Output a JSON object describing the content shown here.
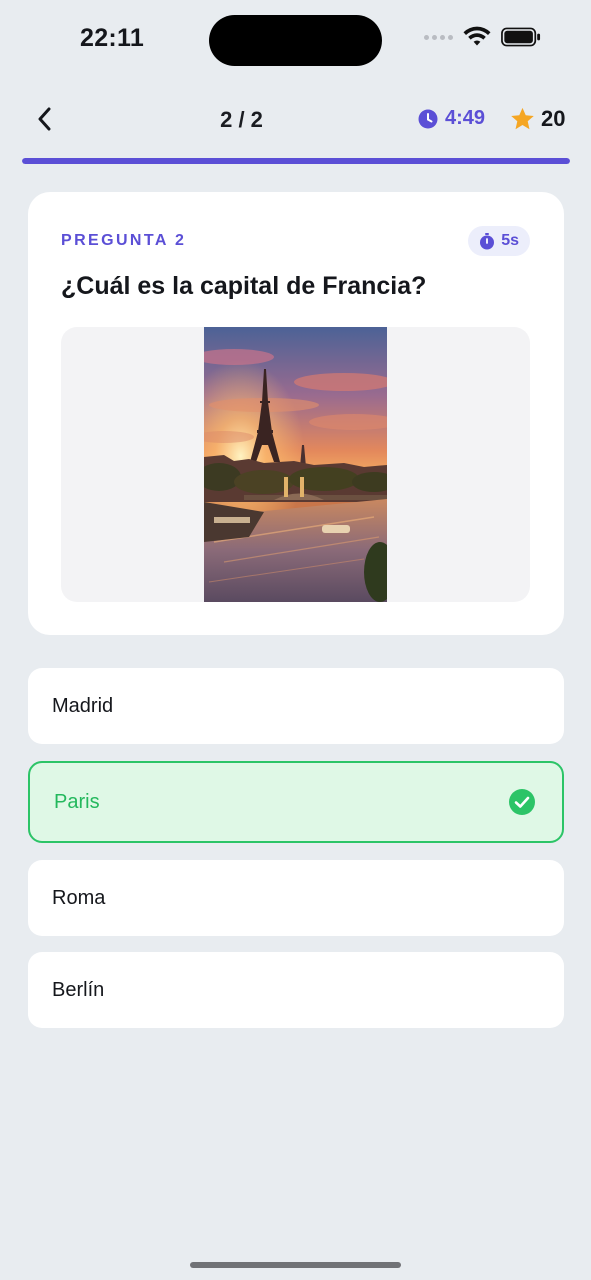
{
  "status_bar": {
    "time": "22:11"
  },
  "header": {
    "back_icon": "chevron-left-icon",
    "progress_text": "2 / 2",
    "timer_icon": "clock-icon",
    "timer_value": "4:49",
    "star_icon": "star-icon",
    "points": "20",
    "progress_fraction": 1.0,
    "accent_color": "#5b4fd6"
  },
  "question": {
    "label": "PREGUNTA 2",
    "time_badge_icon": "stopwatch-icon",
    "time_badge": "5s",
    "text": "¿Cuál es la capital de Francia?",
    "image_icon": "eiffel-tower-photo"
  },
  "options": [
    {
      "label": "Madrid",
      "state": "default"
    },
    {
      "label": "Paris",
      "state": "correct",
      "icon": "check-circle-icon",
      "color": "#2cc467"
    },
    {
      "label": "Roma",
      "state": "default"
    },
    {
      "label": "Berlín",
      "state": "default"
    }
  ]
}
